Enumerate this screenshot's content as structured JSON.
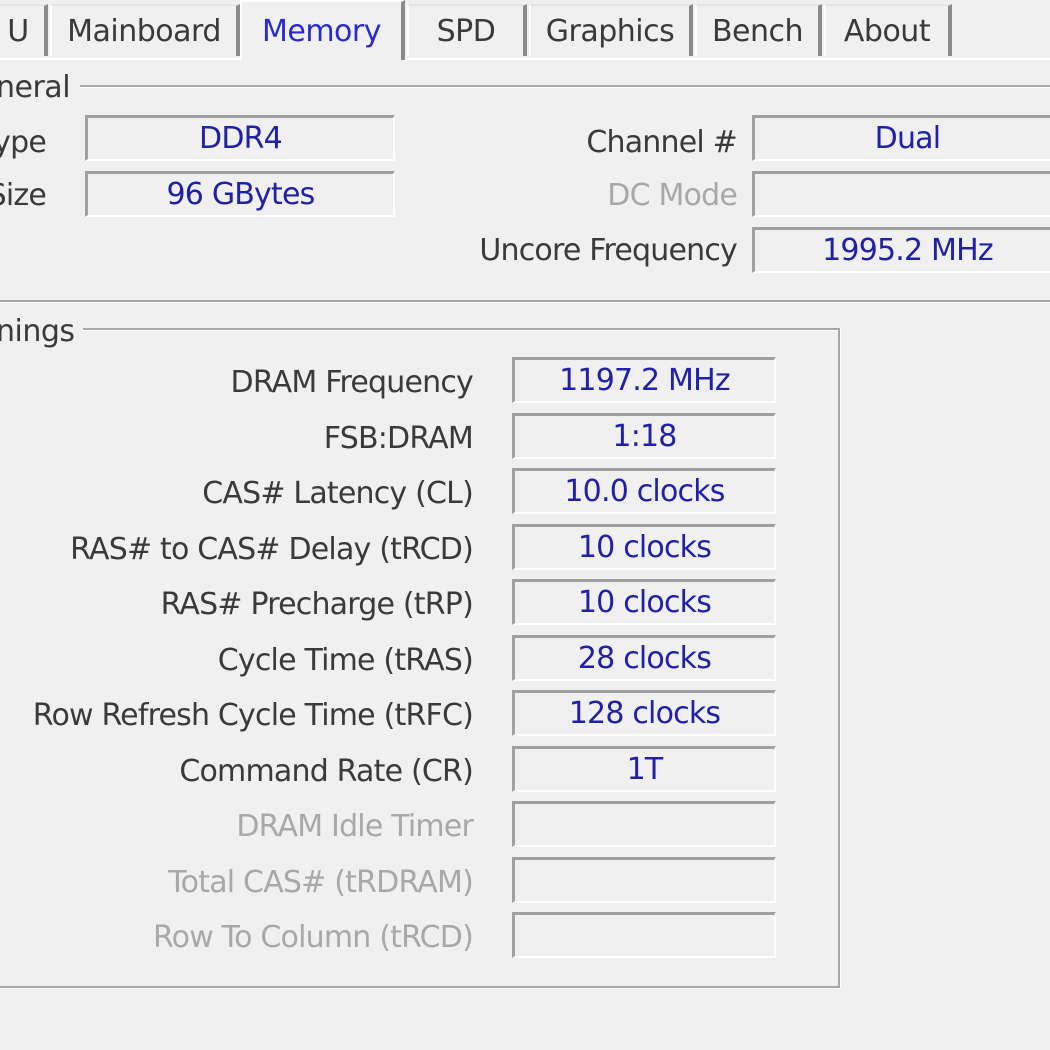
{
  "tabs": [
    {
      "id": "cpu",
      "label": "U"
    },
    {
      "id": "mainboard",
      "label": "Mainboard"
    },
    {
      "id": "memory",
      "label": "Memory",
      "active": true
    },
    {
      "id": "spd",
      "label": "SPD"
    },
    {
      "id": "graphics",
      "label": "Graphics"
    },
    {
      "id": "bench",
      "label": "Bench"
    },
    {
      "id": "about",
      "label": "About"
    }
  ],
  "general": {
    "title": "neral",
    "type_label": "ype",
    "type_value": "DDR4",
    "size_label": "Size",
    "size_value": "96 GBytes",
    "channel_label": "Channel #",
    "channel_value": "Dual",
    "dc_mode_label": "DC Mode",
    "dc_mode_value": "",
    "uncore_label": "Uncore Frequency",
    "uncore_value": "1995.2 MHz"
  },
  "timings": {
    "title": "nings",
    "rows": [
      {
        "label": "DRAM Frequency",
        "value": "1197.2 MHz",
        "enabled": true
      },
      {
        "label": "FSB:DRAM",
        "value": "1:18",
        "enabled": true
      },
      {
        "label": "CAS# Latency (CL)",
        "value": "10.0 clocks",
        "enabled": true
      },
      {
        "label": "RAS# to CAS# Delay (tRCD)",
        "value": "10 clocks",
        "enabled": true
      },
      {
        "label": "RAS# Precharge (tRP)",
        "value": "10 clocks",
        "enabled": true
      },
      {
        "label": "Cycle Time (tRAS)",
        "value": "28 clocks",
        "enabled": true
      },
      {
        "label": "Row Refresh Cycle Time (tRFC)",
        "value": "128 clocks",
        "enabled": true
      },
      {
        "label": "Command Rate (CR)",
        "value": "1T",
        "enabled": true
      },
      {
        "label": "DRAM Idle Timer",
        "value": "",
        "enabled": false
      },
      {
        "label": "Total CAS# (tRDRAM)",
        "value": "",
        "enabled": false
      },
      {
        "label": "Row To Column (tRCD)",
        "value": "",
        "enabled": false
      }
    ]
  },
  "colors": {
    "value_text": "#2020a8",
    "active_tab_text": "#2a2ad0",
    "disabled_text": "#a8a8a8",
    "background": "#f0f0f0"
  }
}
